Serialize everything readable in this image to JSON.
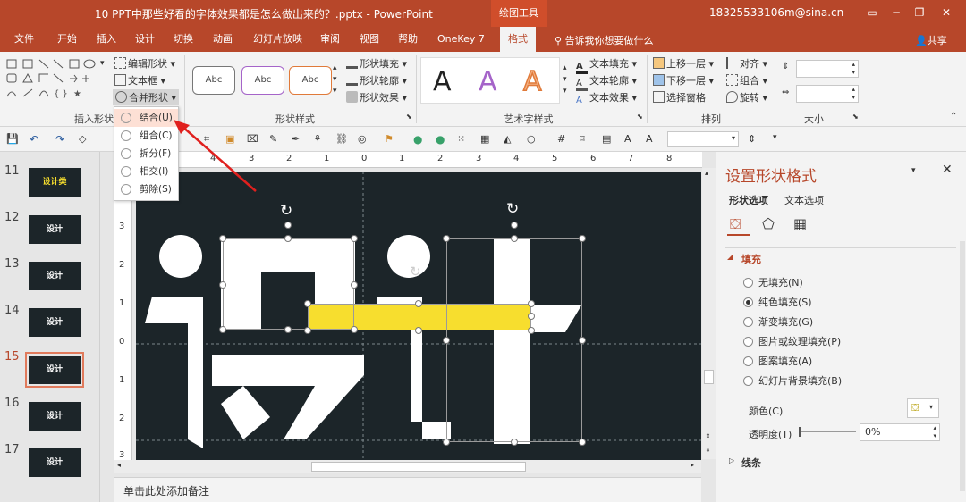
{
  "window": {
    "title": "10 PPT中那些好看的字体效果都是怎么做出来的？.pptx  -  PowerPoint",
    "context_tab": "绘图工具",
    "user": "18325533106m@sina.cn"
  },
  "tabs": [
    "文件",
    "开始",
    "插入",
    "设计",
    "切换",
    "动画",
    "幻灯片放映",
    "审阅",
    "视图",
    "帮助",
    "OneKey 7",
    "格式"
  ],
  "tell_me": "告诉我你想要做什么",
  "share": "共享",
  "ribbon": {
    "insert_shapes": {
      "label": "插入形状",
      "edit_shape": "编辑形状",
      "text_box": "文本框",
      "merge_shapes": "合并形状"
    },
    "shape_styles": {
      "label": "形状样式",
      "style_samples": [
        "Abc",
        "Abc",
        "Abc"
      ],
      "shape_fill": "形状填充",
      "shape_outline": "形状轮廓",
      "shape_effects": "形状效果"
    },
    "wordart": {
      "label": "艺术字样式",
      "samples": [
        "A",
        "A",
        "A"
      ],
      "text_fill": "文本填充",
      "text_outline": "文本轮廓",
      "text_effects": "文本效果"
    },
    "arrange": {
      "label": "排列",
      "bring_forward": "上移一层",
      "send_backward": "下移一层",
      "selection_pane": "选择窗格",
      "align": "对齐",
      "group": "组合",
      "rotate": "旋转"
    },
    "size": {
      "label": "大小"
    }
  },
  "merge_menu": {
    "items": [
      {
        "label": "结合(U)",
        "highlighted": true
      },
      {
        "label": "组合(C)",
        "highlighted": false
      },
      {
        "label": "拆分(F)",
        "highlighted": false
      },
      {
        "label": "相交(I)",
        "highlighted": false
      },
      {
        "label": "剪除(S)",
        "highlighted": false
      }
    ]
  },
  "slides": [
    {
      "num": "11",
      "text": "设计类",
      "selected": false
    },
    {
      "num": "12",
      "text": "设计",
      "selected": false
    },
    {
      "num": "13",
      "text": "设计",
      "selected": false
    },
    {
      "num": "14",
      "text": "设计",
      "selected": false
    },
    {
      "num": "15",
      "text": "设计",
      "selected": true
    },
    {
      "num": "16",
      "text": "设计",
      "selected": false
    },
    {
      "num": "17",
      "text": "设计",
      "selected": false
    }
  ],
  "hruler_labels": [
    "4",
    "3",
    "2",
    "1",
    "0",
    "1",
    "2",
    "3",
    "4",
    "5",
    "6",
    "7",
    "8"
  ],
  "vruler_labels": [
    "3",
    "2",
    "1",
    "0",
    "1",
    "2",
    "3"
  ],
  "notes_placeholder": "单击此处添加备注",
  "format_panel": {
    "title": "设置形状格式",
    "tabs": [
      "形状选项",
      "文本选项"
    ],
    "fill_section": "填充",
    "fill_options": [
      {
        "label": "无填充(N)",
        "selected": false
      },
      {
        "label": "纯色填充(S)",
        "selected": true
      },
      {
        "label": "渐变填充(G)",
        "selected": false
      },
      {
        "label": "图片或纹理填充(P)",
        "selected": false
      },
      {
        "label": "图案填充(A)",
        "selected": false
      },
      {
        "label": "幻灯片背景填充(B)",
        "selected": false
      }
    ],
    "color_label": "颜色(C)",
    "transparency_label": "透明度(T)",
    "transparency_value": "0%",
    "line_section": "线条"
  },
  "colors": {
    "accent": "#b7472a",
    "slide_bg": "#1c2529",
    "highlight_bar": "#f7de2e",
    "arrow": "#e0201e"
  }
}
